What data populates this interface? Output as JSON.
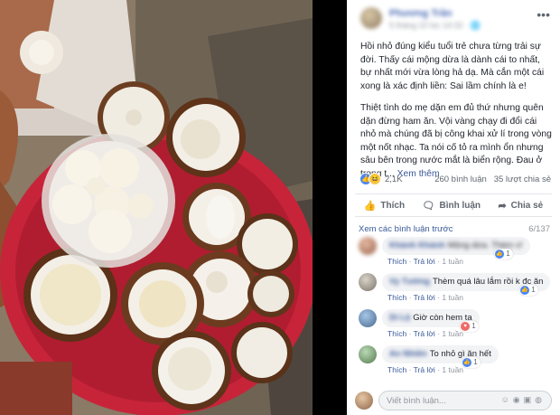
{
  "post": {
    "author": "Phương Trần",
    "meta": "5 tháng 10 lúc 14:32 · 🌐",
    "caption_paragraph_1": "Hồi nhỏ đúng kiểu tuổi trẻ chưa từng trải sự đời. Thấy cái mộng dừa là dành cái to nhất, bự nhất mới vừa lòng hả dạ. Mà cắn một cái xong là xác định liền: Sai lầm chính là e!",
    "caption_paragraph_2": "Thiệt tình do mẹ dặn em đủ thứ nhưng quên dặn đừng ham ăn. Vội vàng chạy đi đổi cái nhỏ mà chúng đã bị công khai xử lí trong vòng một nốt nhạc. Ta nói cố tỏ ra mình ổn nhưng sâu bên trong nước mắt là biển rộng. Đau ở trong t...",
    "see_more": "Xem thêm",
    "more_icon": "more-horizontal-icon"
  },
  "stats": {
    "reaction_count": "2,1K",
    "comments": "260 bình luận",
    "shares": "35 lượt chia sẻ"
  },
  "actions": {
    "like": "Thích",
    "comment": "Bình luận",
    "share": "Chia sẻ"
  },
  "comments_header": {
    "view_previous": "Xem các bình luận trước",
    "count": "6/137"
  },
  "comments": [
    {
      "name": "Khánh Khánh",
      "text": "Mộng dừa. Thèm v!",
      "like_label": "Thích",
      "reply_label": "Trả lời",
      "time": "1 tuần",
      "likes": "1",
      "reaction": "like"
    },
    {
      "name": "Vy Tường",
      "text": "Thèm quá lâu lắm rồi k đc ăn",
      "like_label": "Thích",
      "reply_label": "Trả lời",
      "time": "1 tuần",
      "likes": "1",
      "reaction": "like"
    },
    {
      "name": "Di Lệ",
      "text": "Giờ còn hem ta",
      "like_label": "Thích",
      "reply_label": "Trả lời",
      "time": "1 tuần",
      "likes": "1",
      "reaction": "love"
    },
    {
      "name": "An Nhiên",
      "text": "To nhỏ gì ăn hết",
      "like_label": "Thích",
      "reply_label": "Trả lời",
      "time": "1 tuần",
      "likes": "1",
      "reaction": "like"
    }
  ],
  "compose": {
    "placeholder": "Viết bình luận..."
  },
  "colors": {
    "link": "#385898",
    "like_blue": "#4a86f5",
    "bubble_bg": "#f2f3f5"
  }
}
